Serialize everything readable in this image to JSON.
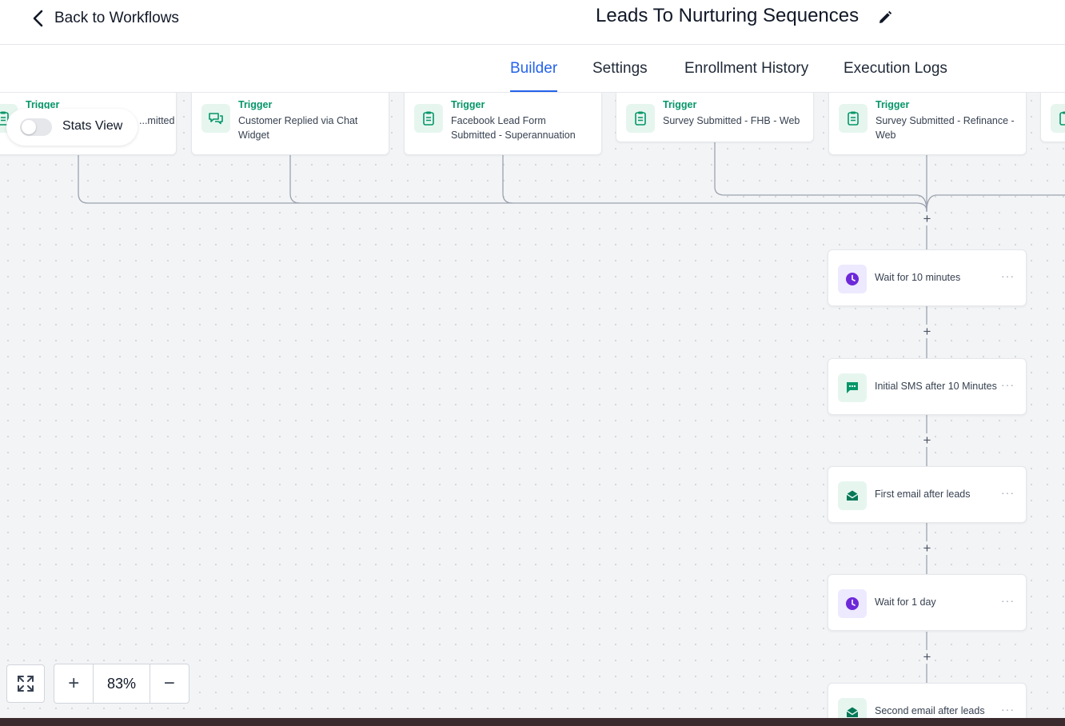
{
  "header": {
    "back_label": "Back to Workflows",
    "title": "Leads To Nurturing Sequences"
  },
  "tabs": [
    {
      "label": "Builder",
      "active": true
    },
    {
      "label": "Settings",
      "active": false
    },
    {
      "label": "Enrollment History",
      "active": false
    },
    {
      "label": "Execution Logs",
      "active": false
    }
  ],
  "stats_view": {
    "label": "Stats View",
    "enabled": false
  },
  "triggers": [
    {
      "label": "Trigger",
      "name": "...mitted",
      "icon": "clipboard-icon"
    },
    {
      "label": "Trigger",
      "name": "Customer Replied via Chat Widget",
      "icon": "chat-icon"
    },
    {
      "label": "Trigger",
      "name": "Facebook Lead Form Submitted - Superannuation",
      "icon": "clipboard-icon"
    },
    {
      "label": "Trigger",
      "name": "Survey Submitted - FHB - Web",
      "icon": "clipboard-icon"
    },
    {
      "label": "Trigger",
      "name": "Survey Submitted - Refinance - Web",
      "icon": "clipboard-icon"
    }
  ],
  "actions": [
    {
      "name": "Wait for 10 minutes",
      "icon": "clock-icon",
      "color": "#6d28d9"
    },
    {
      "name": "Initial SMS after 10 Minutes",
      "icon": "sms-icon",
      "color": "#059669"
    },
    {
      "name": "First email after leads",
      "icon": "email-icon",
      "color": "#047857"
    },
    {
      "name": "Wait for 1 day",
      "icon": "clock-icon",
      "color": "#6d28d9"
    },
    {
      "name": "Second email after leads",
      "icon": "email-icon",
      "color": "#047857"
    }
  ],
  "zoom": {
    "value": "83%",
    "in_symbol": "+",
    "out_symbol": "−"
  },
  "plus_symbol": "+",
  "more_symbol": "···",
  "colors": {
    "accent": "#2563eb",
    "trigger_green": "#059669",
    "wait_purple": "#6d28d9"
  }
}
